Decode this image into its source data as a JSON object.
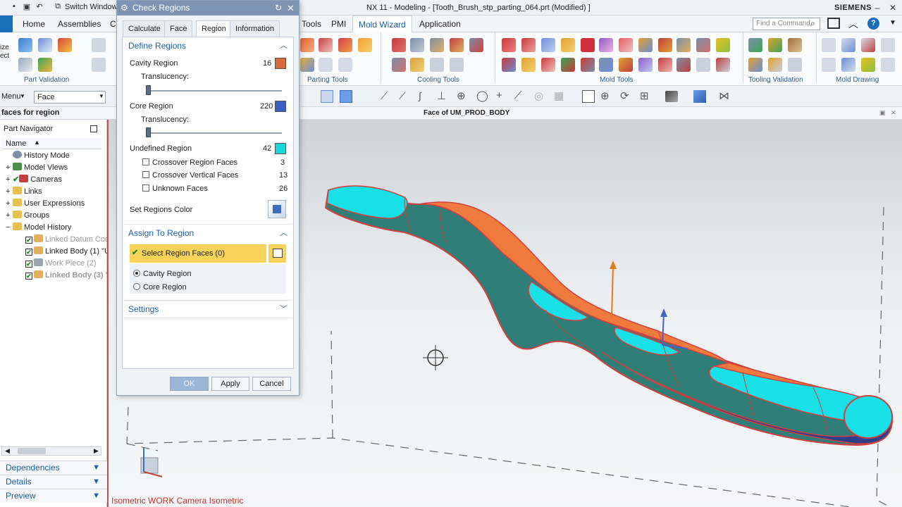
{
  "app": {
    "title": "NX 11 - Modeling - [Tooth_Brush_stp_parting_064.prt (Modified) ]",
    "brand": "SIEMENS",
    "switch_window": "Switch Window"
  },
  "ribbon_tabs": [
    "Home",
    "Assemblies",
    "C",
    "Tools",
    "PMI",
    "Mold Wizard",
    "Application"
  ],
  "active_tab": "Mold Wizard",
  "search": {
    "placeholder": "Find a Command"
  },
  "ribbon_groups": [
    "Part Validation",
    "Parting Tools",
    "Cooling Tools",
    "Mold Tools",
    "Tooling Validation",
    "Mold Drawing"
  ],
  "ribbon_side_text": [
    "ize",
    "ect"
  ],
  "selection_bar": {
    "menu_label": "Menu",
    "filter_value": "Face"
  },
  "cue_line": "faces for region",
  "viewport_title": "Face of UM_PROD_BODY",
  "viewport_footer": "Isometric WORK Camera Isometric",
  "navigator": {
    "title": "Part Navigator",
    "column": "Name",
    "items": [
      {
        "label": "History Mode",
        "indent": 1
      },
      {
        "label": "Model Views",
        "indent": 1
      },
      {
        "label": "Cameras",
        "indent": 1
      },
      {
        "label": "Links",
        "indent": 1
      },
      {
        "label": "User Expressions",
        "indent": 1
      },
      {
        "label": "Groups",
        "indent": 1
      },
      {
        "label": "Model History",
        "indent": 1
      },
      {
        "label": "Linked Datum Coo",
        "indent": 2,
        "dim": true
      },
      {
        "label": "Linked Body (1) \"U",
        "indent": 2
      },
      {
        "label": "Work Piece (2)",
        "indent": 2,
        "dim": true
      },
      {
        "label": "Linked Body (3) \"",
        "indent": 2,
        "dim": true
      }
    ],
    "accordions": [
      "Dependencies",
      "Details",
      "Preview"
    ]
  },
  "dialog": {
    "title": "Check Regions",
    "tabs": [
      "Calculate",
      "Face",
      "Region",
      "Information"
    ],
    "active_tab": "Region",
    "define_regions": {
      "header": "Define Regions",
      "cavity_label": "Cavity Region",
      "cavity_count": "16",
      "cavity_color": "#d9683a",
      "translucency_label": "Translucency:",
      "cavity_translucency": 0.0,
      "core_label": "Core Region",
      "core_count": "220",
      "core_color": "#3a5fc4",
      "core_translucency": 0.0,
      "undefined_label": "Undefined Region",
      "undefined_count": "42",
      "undefined_color": "#19d6d8",
      "crossover_faces_label": "Crossover Region Faces",
      "crossover_faces_count": "3",
      "crossover_vertical_label": "Crossover Vertical Faces",
      "crossover_vertical_count": "13",
      "unknown_faces_label": "Unknown Faces",
      "unknown_faces_count": "26",
      "set_color_label": "Set Regions Color"
    },
    "assign": {
      "header": "Assign To Region",
      "select_label": "Select Region Faces (0)",
      "options": [
        "Cavity Region",
        "Core Region"
      ],
      "selected": "Cavity Region"
    },
    "settings_header": "Settings",
    "buttons": {
      "ok": "OK",
      "apply": "Apply",
      "cancel": "Cancel"
    }
  },
  "colors": {
    "accent": "#1b5da8",
    "select_highlight": "#f7d35a",
    "part_orange": "#f07a3e",
    "part_cyan": "#17e0e6",
    "part_teal": "#2f7f78",
    "part_navy": "#2c3e8c"
  }
}
